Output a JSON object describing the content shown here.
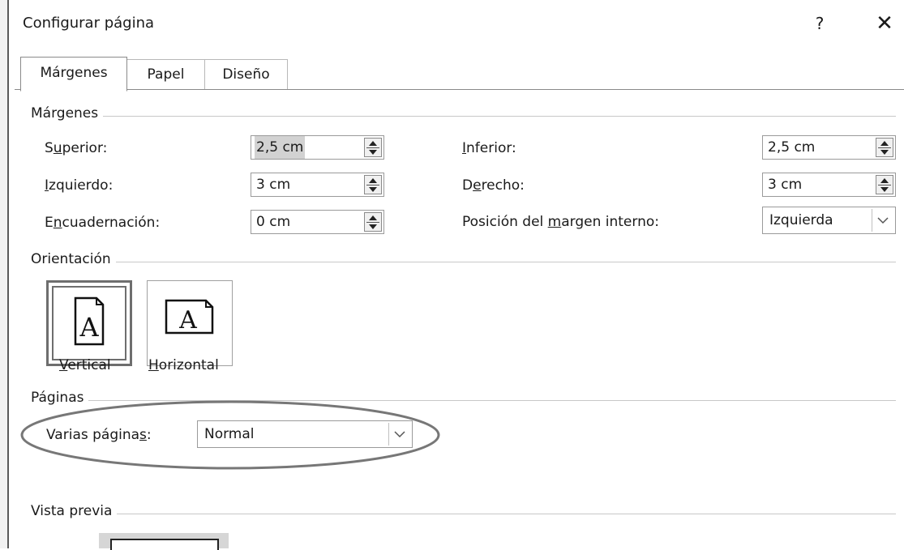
{
  "dialog": {
    "title": "Configurar página",
    "help_label": "?",
    "close_label": "✕"
  },
  "tabs": [
    {
      "label": "Márgenes",
      "active": true
    },
    {
      "label": "Papel",
      "active": false
    },
    {
      "label": "Diseño",
      "active": false
    }
  ],
  "margins": {
    "section_label": "Márgenes",
    "superior": {
      "pre": "S",
      "key": "u",
      "post": "perior:",
      "value": "2,5 cm"
    },
    "izquierdo": {
      "pre": "",
      "key": "I",
      "post": "zquierdo:",
      "value": "3 cm"
    },
    "encuadernacion": {
      "pre": "E",
      "key": "n",
      "post": "cuadernación:",
      "value": "0 cm"
    },
    "inferior": {
      "pre": "",
      "key": "I",
      "post": "nferior:",
      "value": "2,5 cm"
    },
    "derecho": {
      "pre": "D",
      "key": "e",
      "post": "recho:",
      "value": "3 cm"
    },
    "posicion": {
      "pre": "Posición del ",
      "key": "m",
      "post": "argen interno:",
      "value": "Izquierda"
    }
  },
  "orientation": {
    "section_label": "Orientación",
    "icon_letter": "A",
    "vertical": {
      "key": "V",
      "post": "ertical",
      "selected": true
    },
    "horizontal": {
      "key": "H",
      "post": "orizontal",
      "selected": false
    }
  },
  "pages": {
    "section_label": "Páginas",
    "multi": {
      "pre": "Varias página",
      "key": "s",
      "post": ":",
      "value": "Normal"
    }
  },
  "preview": {
    "section_label": "Vista previa"
  },
  "colors": {
    "annotation_ellipse": "#777777",
    "selected_field": "#d2d2d2"
  }
}
